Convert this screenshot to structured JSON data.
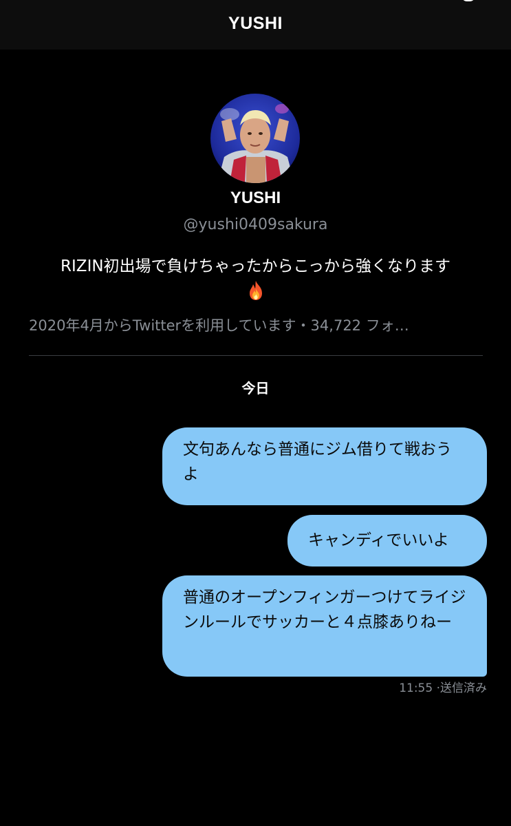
{
  "header": {
    "title": "YUSHI"
  },
  "profile": {
    "name": "YUSHI",
    "handle": "@yushi0409sakura",
    "bio": "RIZIN初出場で負けちゃったからこっから強くなります",
    "bio_emoji": "fire-icon",
    "meta": "2020年4月からTwitterを利用しています・34,722 フォ…"
  },
  "conversation": {
    "date_label": "今日",
    "messages": [
      {
        "text": "文句あんなら普通にジム借りて戦おうよ"
      },
      {
        "text": "キャンディでいいよ"
      },
      {
        "text": "普通のオープンフィンガーつけてライジンルールでサッカーと４点膝ありねー"
      }
    ],
    "last_time": "11:55",
    "last_status": "·送信済み"
  },
  "colors": {
    "background": "#000000",
    "header_bg": "#0d0d0d",
    "bubble": "#86c8f7",
    "secondary_text": "#8a8f96"
  }
}
